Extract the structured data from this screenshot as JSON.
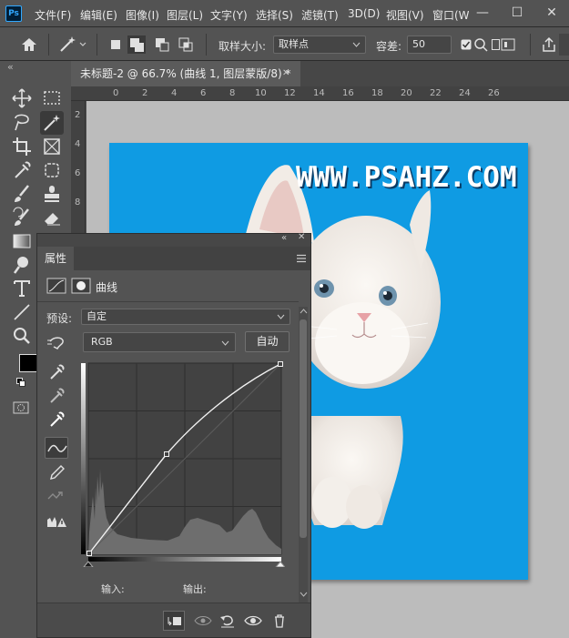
{
  "app": {
    "logo": "Ps"
  },
  "menu": [
    "文件(F)",
    "编辑(E)",
    "图像(I)",
    "图层(L)",
    "文字(Y)",
    "选择(S)",
    "滤镜(T)",
    "3D(D)",
    "视图(V)",
    "窗口(W"
  ],
  "window_controls": {
    "minimize": "—",
    "maximize": "☐",
    "close": "✕"
  },
  "options": {
    "sample_size_label": "取样大小:",
    "sample_size_value": "取样点",
    "tolerance_label": "容差:",
    "tolerance_value": "50"
  },
  "document": {
    "tab_title": "未标题-2 @ 66.7% (曲线 1, 图层蒙版/8) *",
    "close": "✕",
    "watermark": "WWW.PSAHZ.COM",
    "ruler_h": [
      "0",
      "2",
      "4",
      "6",
      "8",
      "10",
      "12",
      "14",
      "16",
      "18",
      "20",
      "22",
      "24",
      "26"
    ],
    "ruler_v": [
      "2",
      "4",
      "6",
      "8"
    ]
  },
  "properties": {
    "tab": "属性",
    "title": "曲线",
    "preset_label": "预设:",
    "preset_value": "自定",
    "channel": "RGB",
    "auto_button": "自动",
    "input_label": "输入:",
    "output_label": "输出:"
  },
  "colors": {
    "canvas_bg": "#0f9be3",
    "ui_bg": "#535353",
    "accent": "#31a8ff"
  }
}
